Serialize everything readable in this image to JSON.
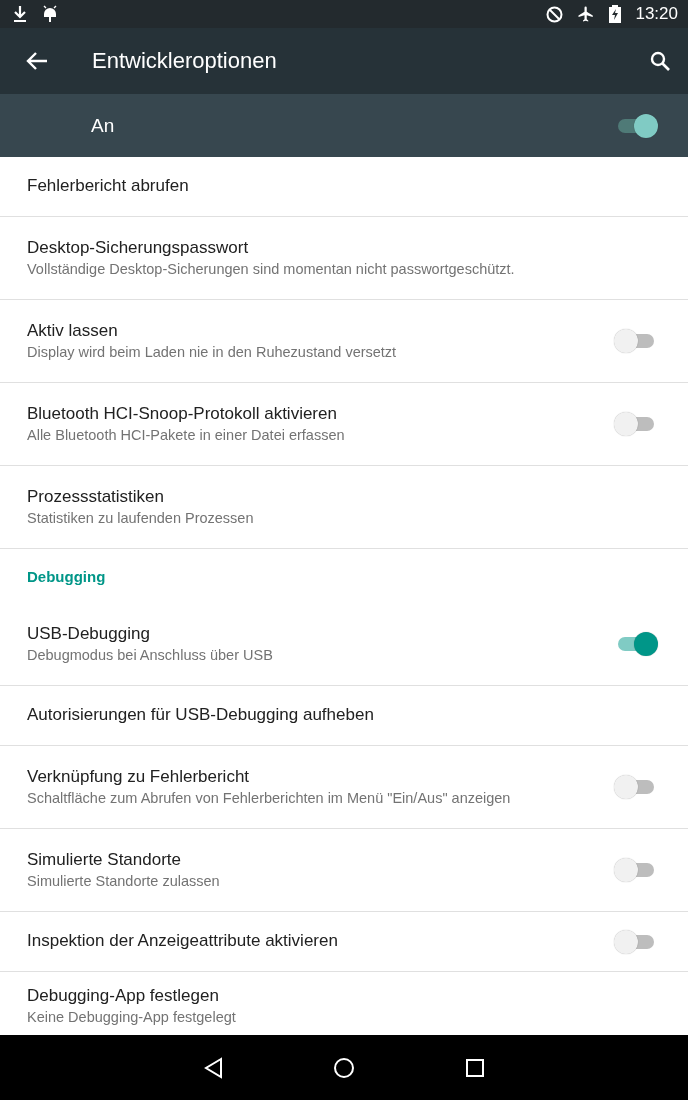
{
  "status_bar": {
    "time": "13:20"
  },
  "toolbar": {
    "title": "Entwickleroptionen"
  },
  "master_switch": {
    "label": "An",
    "on": true
  },
  "items": [
    {
      "kind": "plain",
      "title": "Fehlerbericht abrufen"
    },
    {
      "kind": "plain",
      "title": "Desktop-Sicherungspasswort",
      "subtitle": "Vollständige Desktop-Sicherungen sind momentan nicht passwortgeschützt."
    },
    {
      "kind": "switch",
      "title": "Aktiv lassen",
      "subtitle": "Display wird beim Laden nie in den Ruhezustand versetzt",
      "on": false
    },
    {
      "kind": "switch",
      "title": "Bluetooth HCI-Snoop-Protokoll aktivieren",
      "subtitle": "Alle Bluetooth HCI-Pakete in einer Datei erfassen",
      "on": false
    },
    {
      "kind": "plain",
      "title": "Prozessstatistiken",
      "subtitle": "Statistiken zu laufenden Prozessen"
    },
    {
      "kind": "header",
      "title": "Debugging"
    },
    {
      "kind": "switch",
      "title": "USB-Debugging",
      "subtitle": "Debugmodus bei Anschluss über USB",
      "on": true
    },
    {
      "kind": "plain",
      "title": "Autorisierungen für USB-Debugging aufheben"
    },
    {
      "kind": "switch",
      "title": "Verknüpfung zu Fehlerbericht",
      "subtitle": "Schaltfläche zum Abrufen von Fehlerberichten im Menü \"Ein/Aus\" anzeigen",
      "on": false
    },
    {
      "kind": "switch",
      "title": "Simulierte Standorte",
      "subtitle": "Simulierte Standorte zulassen",
      "on": false
    },
    {
      "kind": "switch",
      "title": "Inspektion der Anzeigeattribute aktivieren",
      "on": false
    },
    {
      "kind": "plain",
      "title": "Debugging-App festlegen",
      "subtitle": "Keine Debugging-App festgelegt"
    }
  ]
}
